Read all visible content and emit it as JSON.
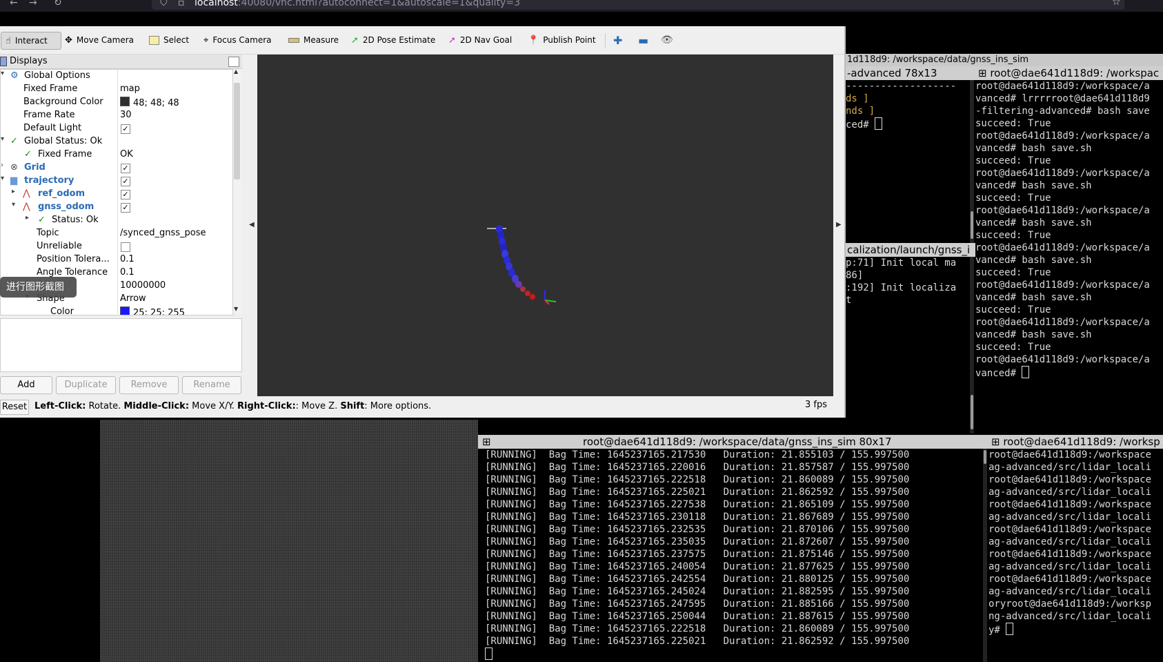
{
  "browser": {
    "url_host": "localhost",
    "url_rest": ":40080/vnc.html?autoconnect=1&autoscale=1&quality=3"
  },
  "rviz": {
    "toolbar": [
      {
        "label": "Interact",
        "icon": "hand-icon",
        "active": true
      },
      {
        "label": "Move Camera",
        "icon": "move-camera-icon"
      },
      {
        "label": "Select",
        "icon": "select-icon"
      },
      {
        "label": "Focus Camera",
        "icon": "focus-camera-icon"
      },
      {
        "label": "Measure",
        "icon": "ruler-icon"
      },
      {
        "label": "2D Pose Estimate",
        "icon": "pose-estimate-arrow-icon"
      },
      {
        "label": "2D Nav Goal",
        "icon": "nav-goal-arrow-icon"
      },
      {
        "label": "Publish Point",
        "icon": "map-pin-icon"
      }
    ],
    "displays_title": "Displays",
    "tree": {
      "global_options": "Global Options",
      "fixed_frame_label": "Fixed Frame",
      "fixed_frame_value": "map",
      "background_color_label": "Background Color",
      "background_color_value": "48; 48; 48",
      "background_swatch": "#303030",
      "frame_rate_label": "Frame Rate",
      "frame_rate_value": "30",
      "default_light_label": "Default Light",
      "global_status": "Global Status: Ok",
      "gs_fixed_frame_label": "Fixed Frame",
      "gs_fixed_frame_value": "OK",
      "grid": "Grid",
      "trajectory": "trajectory",
      "ref_odom": "ref_odom",
      "gnss_odom": "gnss_odom",
      "status_ok": "Status: Ok",
      "topic_label": "Topic",
      "topic_value": "/synced_gnss_pose",
      "unreliable_label": "Unreliable",
      "position_tolerance_label": "Position Tolera...",
      "position_tolerance_value": "0.1",
      "angle_tolerance_label": "Angle Tolerance",
      "angle_tolerance_value": "0.1",
      "keep_value": "10000000",
      "shape_label": "Shape",
      "shape_value": "Arrow",
      "color_label": "Color",
      "color_value": "25; 25; 255",
      "color_swatch": "#1919ff"
    },
    "buttons": {
      "add": "Add",
      "duplicate": "Duplicate",
      "remove": "Remove",
      "rename": "Rename"
    },
    "status": {
      "reset": "Reset",
      "left_click": "Left-Click:",
      "left_click_desc": " Rotate. ",
      "middle_click": "Middle-Click:",
      "middle_click_desc": " Move X/Y. ",
      "right_click": "Right-Click:",
      "right_click_desc": ": Move Z. ",
      "shift": "Shift",
      "shift_desc": ": More options.",
      "fps": "3 fps"
    }
  },
  "screenshot_tooltip": "进行图形截图",
  "terminals": {
    "top_title": "1d118d9: /workspace/data/gnss_ins_sim",
    "mid_title": "-advanced 78x13",
    "mid_lines": [
      "-------------------",
      "",
      "",
      "",
      "ds ]",
      "nds ]",
      "",
      "",
      "",
      "",
      "",
      "ced# "
    ],
    "mid2_title": "calization/launch/gnss_i",
    "mid2_lines": [
      "",
      "",
      "",
      "",
      "p:71] Init local ma",
      "",
      "86]",
      "",
      "",
      "",
      ":192] Init localiza",
      "t"
    ],
    "right_title": "root@dae641d118d9: /workspac",
    "right_lines": [
      "root@dae641d118d9:/workspace/a",
      "vanced# lrrrrroot@dae641d118d9",
      "-filtering-advanced# bash save",
      "succeed: True",
      "root@dae641d118d9:/workspace/a",
      "vanced# bash save.sh",
      "succeed: True",
      "root@dae641d118d9:/workspace/a",
      "vanced# bash save.sh",
      "succeed: True",
      "root@dae641d118d9:/workspace/a",
      "vanced# bash save.sh",
      "succeed: True",
      "root@dae641d118d9:/workspace/a",
      "vanced# bash save.sh",
      "succeed: True",
      "root@dae641d118d9:/workspace/a",
      "vanced# bash save.sh",
      "succeed: True",
      "root@dae641d118d9:/workspace/a",
      "vanced# bash save.sh",
      "succeed: True",
      "root@dae641d118d9:/workspace/a",
      "vanced# "
    ],
    "bottom_title": "root@dae641d118d9: /workspace/data/gnss_ins_sim 80x17",
    "bottom_lines": [
      "[RUNNING]  Bag Time: 1645237165.217530   Duration: 21.855103 / 155.997500",
      "[RUNNING]  Bag Time: 1645237165.220016   Duration: 21.857587 / 155.997500",
      "[RUNNING]  Bag Time: 1645237165.222518   Duration: 21.860089 / 155.997500",
      "[RUNNING]  Bag Time: 1645237165.225021   Duration: 21.862592 / 155.997500",
      "[RUNNING]  Bag Time: 1645237165.227538   Duration: 21.865109 / 155.997500",
      "[RUNNING]  Bag Time: 1645237165.230118   Duration: 21.867689 / 155.997500",
      "[RUNNING]  Bag Time: 1645237165.232535   Duration: 21.870106 / 155.997500",
      "[RUNNING]  Bag Time: 1645237165.235035   Duration: 21.872607 / 155.997500",
      "[RUNNING]  Bag Time: 1645237165.237575   Duration: 21.875146 / 155.997500",
      "[RUNNING]  Bag Time: 1645237165.240054   Duration: 21.877625 / 155.997500",
      "[RUNNING]  Bag Time: 1645237165.242554   Duration: 21.880125 / 155.997500",
      "[RUNNING]  Bag Time: 1645237165.245024   Duration: 21.882595 / 155.997500",
      "[RUNNING]  Bag Time: 1645237165.247595   Duration: 21.885166 / 155.997500",
      "[RUNNING]  Bag Time: 1645237165.250044   Duration: 21.887615 / 155.997500",
      "[RUNNING]  Bag Time: 1645237165.222518   Duration: 21.860089 / 155.997500",
      "[RUNNING]  Bag Time: 1645237165.225021   Duration: 21.862592 / 155.997500",
      ""
    ],
    "br_title": "root@dae641d118d9: /worksp",
    "br_lines": [
      "root@dae641d118d9:/workspace",
      "ag-advanced/src/lidar_locali",
      "root@dae641d118d9:/workspace",
      "ag-advanced/src/lidar_locali",
      "root@dae641d118d9:/workspace",
      "ag-advanced/src/lidar_locali",
      "root@dae641d118d9:/workspace",
      "ag-advanced/src/lidar_locali",
      "root@dae641d118d9:/workspace",
      "ag-advanced/src/lidar_locali",
      "root@dae641d118d9:/workspace",
      "ag-advanced/src/lidar_locali",
      "oryroot@dae641d118d9:/worksp",
      "ng-advanced/src/lidar_locali",
      "y# "
    ]
  },
  "colors": {
    "terminal_bg": "#000000",
    "rviz_view_bg": "#303030",
    "accent_blue": "#2a6bb5",
    "ok_green": "#1b8a1b"
  }
}
